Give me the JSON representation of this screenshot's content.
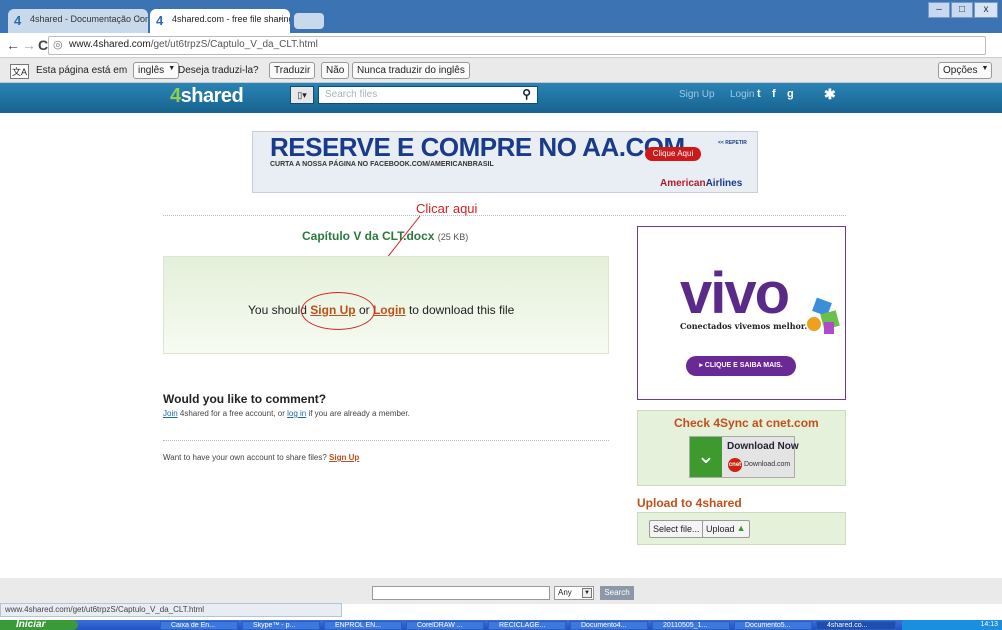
{
  "browser": {
    "tabs": [
      {
        "label": "4shared - Documentação Com",
        "active": false
      },
      {
        "label": "4shared.com - free file sharing",
        "active": true
      }
    ],
    "url_host": "www.4shared.com",
    "url_path": "/get/ut6trpzS/Captulo_V_da_CLT.html",
    "window_buttons": [
      "–",
      "□",
      "x"
    ],
    "translate_bar": {
      "prefix": "Esta página está em",
      "language": "inglês",
      "question": "Deseja traduzi-la?",
      "translate": "Traduzir",
      "no": "Não",
      "never": "Nunca traduzir do inglês",
      "options": "Opções"
    }
  },
  "site": {
    "logo_prefix": "4",
    "logo_text": "shared",
    "search_placeholder": "Search files",
    "signup": "Sign Up",
    "login": "Login",
    "social": [
      "t",
      "f",
      "g"
    ]
  },
  "banner": {
    "headline": "RESERVE E COMPRE NO AA.COM",
    "sub": "CURTA A NOSSA PÁGINA NO FACEBOOK.COM/AMERICANBRASIL",
    "button": "Clique Aqui",
    "repeat": "<< REPETIR",
    "brand_a": "American",
    "brand_b": "Airlines"
  },
  "annotation": {
    "callout": "Clicar aqui"
  },
  "file": {
    "name": "Capítulo V da CLT.docx",
    "size": "(25 KB)"
  },
  "download": {
    "pre": "You should ",
    "signup": "Sign Up",
    "mid": " or ",
    "login": "Login",
    "post": " to download this file"
  },
  "comment": {
    "heading": "Would you like to comment?",
    "join": "Join",
    "text1": " 4shared for a free account, or ",
    "login": "log in",
    "text2": " if you are already a member."
  },
  "own_account": {
    "text": "Want to have your own account to share files?  ",
    "link": "Sign Up"
  },
  "vivo_ad": {
    "logo": "vivo",
    "tagline": "Conectados vivemos melhor.",
    "button": "▸ CLIQUE E SAIBA MAIS."
  },
  "cnet_ad": {
    "heading": "Check 4Sync at cnet.com",
    "button": "Download Now",
    "badge": "cnet",
    "sub": "Download.com"
  },
  "upload": {
    "heading": "Upload to 4shared",
    "select": "Select file...",
    "upload": "Upload"
  },
  "footer": {
    "select_value": "Any",
    "search_button": "Search"
  },
  "status_url": "www.4shared.com/get/ut6trpzS/Captulo_V_da_CLT.html",
  "taskbar": {
    "start": "Iniciar",
    "items": [
      "Caixa de En...",
      "Skype™ - p...",
      "ENPROL EN...",
      "CorelDRAW ...",
      "RECICLAGE...",
      "Documento4...",
      "20110505_1...",
      "Documento5...",
      "4shared.co..."
    ],
    "clock": "14:13"
  }
}
